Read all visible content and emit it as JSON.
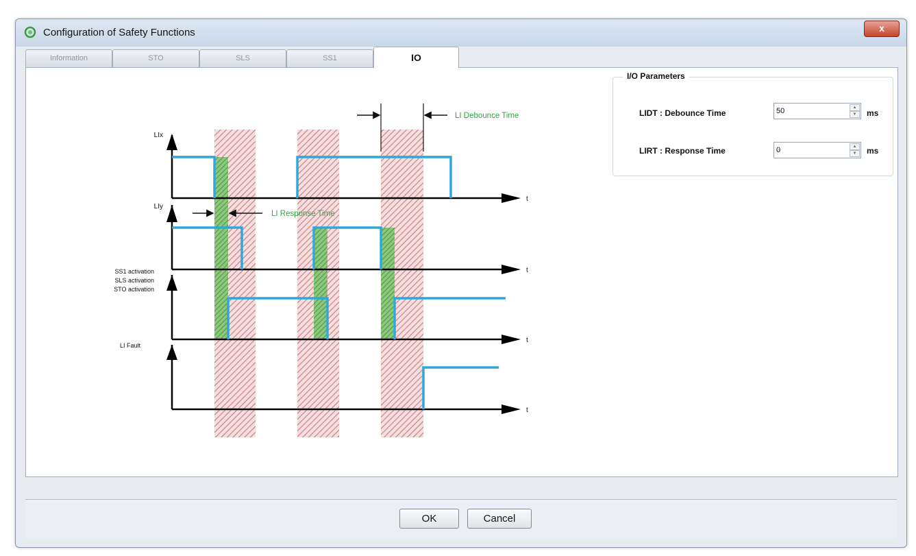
{
  "window": {
    "title": "Configuration of Safety Functions",
    "close_label": "x"
  },
  "tabs": [
    {
      "label": "Information",
      "active": false
    },
    {
      "label": "STO",
      "active": false
    },
    {
      "label": "SLS",
      "active": false
    },
    {
      "label": "SS1",
      "active": false
    },
    {
      "label": "IO",
      "active": true
    }
  ],
  "diagram": {
    "signals": [
      {
        "label": "LIx"
      },
      {
        "label": "LIy"
      },
      {
        "label_lines": [
          "SS1 activation",
          "SLS activation",
          "STO activation"
        ]
      },
      {
        "label": "LI Fault"
      }
    ],
    "time_axis_label": "t",
    "annotations": {
      "debounce": "LI Debounce Time",
      "response": "LI Response Time"
    },
    "colors": {
      "signal": "#2ea8dc",
      "debounce_hatch": "#c97a80",
      "response_hatch": "#5aa04a",
      "annotation_text": "#3aa14a"
    }
  },
  "io_parameters": {
    "title": "I/O Parameters",
    "params": [
      {
        "label": "LIDT : Debounce Time",
        "value": "50",
        "unit": "ms"
      },
      {
        "label": "LIRT : Response Time",
        "value": "0",
        "unit": "ms"
      }
    ]
  },
  "buttons": {
    "ok": "OK",
    "cancel": "Cancel"
  }
}
